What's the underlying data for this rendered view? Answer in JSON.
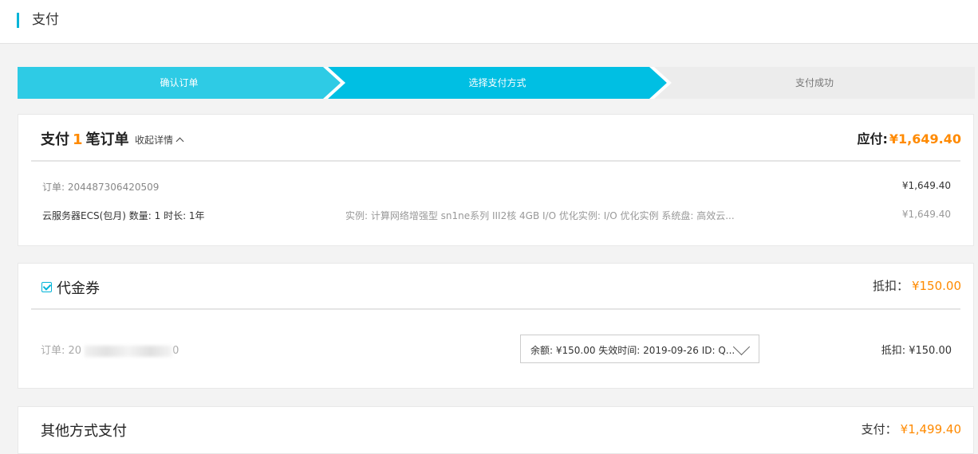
{
  "header": {
    "title": "支付"
  },
  "steps": [
    {
      "label": "确认订单",
      "state": "done"
    },
    {
      "label": "选择支付方式",
      "state": "current"
    },
    {
      "label": "支付成功",
      "state": "pending"
    }
  ],
  "order_summary": {
    "title_prefix": "支付",
    "count": "1",
    "title_suffix": "笔订单",
    "collapse_label": "收起详情",
    "payable_label": "应付:",
    "payable_amount": "¥1,649.40",
    "order_label": "订单: 204487306420509",
    "order_amount": "¥1,649.40",
    "product": "云服务器ECS(包月) 数量: 1 时长: 1年",
    "spec": "实例: 计算网络增强型 sn1ne系列 III2核 4GB I/O 优化实例: I/O 优化实例 系统盘: 高效云...",
    "product_amount": "¥1,649.40"
  },
  "voucher": {
    "checked": true,
    "title": "代金券",
    "deduct_label": "抵扣：",
    "deduct_amount": "¥150.00",
    "order_prefix": "订单: 20",
    "order_suffix": "0",
    "select_value": "余额: ¥150.00 失效时间: 2019-09-26 ID: Q...",
    "row_deduct": "抵扣: ¥150.00"
  },
  "other_payment": {
    "title": "其他方式支付",
    "pay_label": "支付：",
    "pay_amount": "¥1,499.40"
  },
  "colors": {
    "accent": "#00bfe3",
    "price": "#ff8a00"
  }
}
